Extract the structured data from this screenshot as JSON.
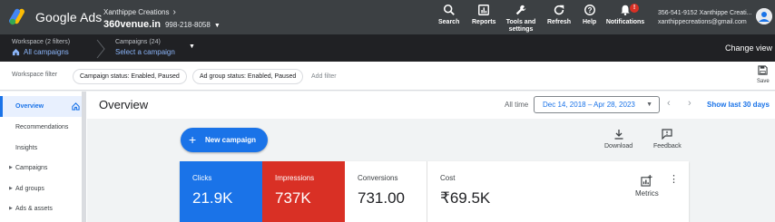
{
  "topbar": {
    "product": "Google Ads",
    "account_name": "Xanthippe Creations",
    "account_site": "360venue.in",
    "account_id": "998-218-8058",
    "tools": [
      {
        "label": "Search",
        "icon": "search-icon"
      },
      {
        "label": "Reports",
        "icon": "reports-icon"
      },
      {
        "label": "Tools and settings",
        "icon": "wrench-icon"
      },
      {
        "label": "Refresh",
        "icon": "refresh-icon"
      },
      {
        "label": "Help",
        "icon": "help-icon"
      },
      {
        "label": "Notifications",
        "icon": "bell-icon",
        "badge": "!"
      }
    ],
    "user_line1": "356-541-9152 Xanthippe Creati...",
    "user_line2": "xanthippecreations@gmail.com"
  },
  "secondbar": {
    "workspace_small": "Workspace (2 filters)",
    "workspace_big": "All campaigns",
    "campaigns_small": "Campaigns (24)",
    "campaigns_big": "Select a campaign",
    "change_view": "Change view"
  },
  "filterbar": {
    "label": "Workspace filter",
    "chips": [
      "Campaign status: Enabled, Paused",
      "Ad group status: Enabled, Paused"
    ],
    "add_filter": "Add filter",
    "save": "Save"
  },
  "sidebar": {
    "items": [
      {
        "label": "Overview",
        "active": true
      },
      {
        "label": "Recommendations"
      },
      {
        "label": "Insights"
      },
      {
        "label": "Campaigns",
        "expandable": true
      },
      {
        "label": "Ad groups",
        "expandable": true
      },
      {
        "label": "Ads & assets",
        "expandable": true
      }
    ]
  },
  "main": {
    "title": "Overview",
    "all_time": "All time",
    "date_range": "Dec 14, 2018 – Apr 28, 2023",
    "show_last": "Show last 30 days",
    "new_campaign": "New campaign",
    "download": "Download",
    "feedback": "Feedback",
    "metrics_label": "Metrics",
    "scorecards": [
      {
        "label": "Clicks",
        "value": "21.9K"
      },
      {
        "label": "Impressions",
        "value": "737K"
      },
      {
        "label": "Conversions",
        "value": "731.00"
      },
      {
        "label": "Cost",
        "value": "₹69.5K"
      }
    ]
  },
  "colors": {
    "topbar": "#3c4043",
    "secondbar": "#202124",
    "accent": "#1a73e8",
    "impressions": "#d93025"
  }
}
